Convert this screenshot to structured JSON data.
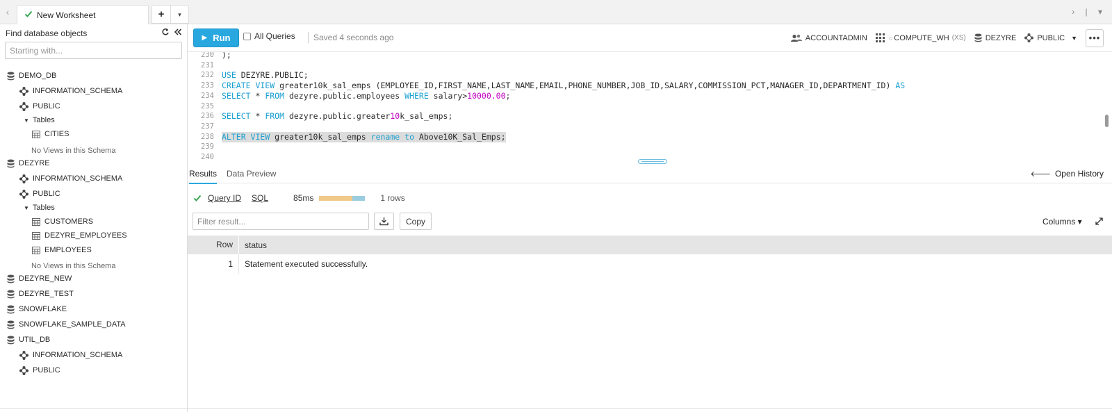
{
  "tabbar": {
    "tab_label": "New Worksheet",
    "add_label": "+",
    "menu_glyph": "▾",
    "right_controls": "› | ▾"
  },
  "sidebar": {
    "find_label": "Find database objects",
    "search_placeholder": "Starting with...",
    "tree": [
      {
        "label": "DEMO_DB",
        "kind": "database",
        "level": 0
      },
      {
        "label": "INFORMATION_SCHEMA",
        "kind": "schema",
        "level": 1
      },
      {
        "label": "PUBLIC",
        "kind": "schema",
        "level": 1
      },
      {
        "label": "Tables",
        "kind": "folder",
        "level": 2
      },
      {
        "label": "CITIES",
        "kind": "table",
        "level": 3
      },
      {
        "label": "No Views in this Schema",
        "kind": "empty",
        "level": 2
      },
      {
        "label": "DEZYRE",
        "kind": "database",
        "level": 0
      },
      {
        "label": "INFORMATION_SCHEMA",
        "kind": "schema",
        "level": 1
      },
      {
        "label": "PUBLIC",
        "kind": "schema",
        "level": 1
      },
      {
        "label": "Tables",
        "kind": "folder",
        "level": 2
      },
      {
        "label": "CUSTOMERS",
        "kind": "table",
        "level": 3
      },
      {
        "label": "DEZYRE_EMPLOYEES",
        "kind": "table",
        "level": 3
      },
      {
        "label": "EMPLOYEES",
        "kind": "table",
        "level": 3
      },
      {
        "label": "No Views in this Schema",
        "kind": "empty",
        "level": 2
      },
      {
        "label": "DEZYRE_NEW",
        "kind": "database",
        "level": 0
      },
      {
        "label": "DEZYRE_TEST",
        "kind": "database",
        "level": 0
      },
      {
        "label": "SNOWFLAKE",
        "kind": "database",
        "level": 0
      },
      {
        "label": "SNOWFLAKE_SAMPLE_DATA",
        "kind": "database",
        "level": 0
      },
      {
        "label": "UTIL_DB",
        "kind": "database",
        "level": 0
      },
      {
        "label": "INFORMATION_SCHEMA",
        "kind": "schema",
        "level": 1
      },
      {
        "label": "PUBLIC",
        "kind": "schema",
        "level": 1
      }
    ]
  },
  "toolbar": {
    "run_label": "Run",
    "all_queries_label": "All Queries",
    "saved_text": "Saved 4 seconds ago",
    "role": "ACCOUNTADMIN",
    "warehouse": "COMPUTE_WH",
    "warehouse_size": "(XS)",
    "database": "DEZYRE",
    "schema": "PUBLIC",
    "more_label": "•••"
  },
  "editor": {
    "lines": [
      {
        "n": "230",
        "tokens": [
          {
            "t": ");",
            "c": ""
          }
        ]
      },
      {
        "n": "231",
        "tokens": []
      },
      {
        "n": "232",
        "tokens": [
          {
            "t": "USE",
            "c": "kw"
          },
          {
            "t": " DEZYRE.PUBLIC;",
            "c": ""
          }
        ]
      },
      {
        "n": "233",
        "tokens": [
          {
            "t": "CREATE VIEW",
            "c": "kw"
          },
          {
            "t": " greater10k_sal_emps (EMPLOYEE_ID,FIRST_NAME,LAST_NAME,EMAIL,PHONE_NUMBER,JOB_ID,SALARY,COMMISSION_PCT,MANAGER_ID,DEPARTMENT_ID) ",
            "c": ""
          },
          {
            "t": "AS",
            "c": "kw"
          }
        ]
      },
      {
        "n": "234",
        "tokens": [
          {
            "t": "SELECT",
            "c": "kw"
          },
          {
            "t": " * ",
            "c": ""
          },
          {
            "t": "FROM",
            "c": "kw"
          },
          {
            "t": " dezyre.public.employees ",
            "c": ""
          },
          {
            "t": "WHERE",
            "c": "kw"
          },
          {
            "t": " salary>",
            "c": ""
          },
          {
            "t": "10000.00",
            "c": "num"
          },
          {
            "t": ";",
            "c": ""
          }
        ]
      },
      {
        "n": "235",
        "tokens": []
      },
      {
        "n": "236",
        "tokens": [
          {
            "t": "SELECT",
            "c": "kw"
          },
          {
            "t": " * ",
            "c": ""
          },
          {
            "t": "FROM",
            "c": "kw"
          },
          {
            "t": " dezyre.public.greater",
            "c": ""
          },
          {
            "t": "10",
            "c": "num"
          },
          {
            "t": "k_sal_emps;",
            "c": ""
          }
        ]
      },
      {
        "n": "237",
        "tokens": []
      },
      {
        "n": "238",
        "selected": true,
        "tokens": [
          {
            "t": "ALTER VIEW",
            "c": "kw"
          },
          {
            "t": " greater10k_sal_emps ",
            "c": ""
          },
          {
            "t": "rename",
            "c": "kw"
          },
          {
            "t": " ",
            "c": ""
          },
          {
            "t": "to",
            "c": "kw"
          },
          {
            "t": " Above10K_Sal_Emps;",
            "c": ""
          }
        ]
      },
      {
        "n": "239",
        "tokens": []
      },
      {
        "n": "240",
        "tokens": []
      }
    ]
  },
  "results": {
    "tabs": [
      "Results",
      "Data Preview"
    ],
    "open_history_label": "Open History",
    "query_id_label": "Query ID",
    "sql_label": "SQL",
    "duration": "85ms",
    "rows_label": "1 rows",
    "filter_placeholder": "Filter result...",
    "copy_label": "Copy",
    "columns_label": "Columns ▾",
    "grid": {
      "columns": [
        "Row",
        "status"
      ],
      "rows": [
        [
          "1",
          "Statement executed successfully."
        ]
      ]
    }
  },
  "colors": {
    "accent": "#29a8e0",
    "keyword": "#1a9fd0",
    "number": "#c000c0",
    "success": "#3aa655"
  }
}
